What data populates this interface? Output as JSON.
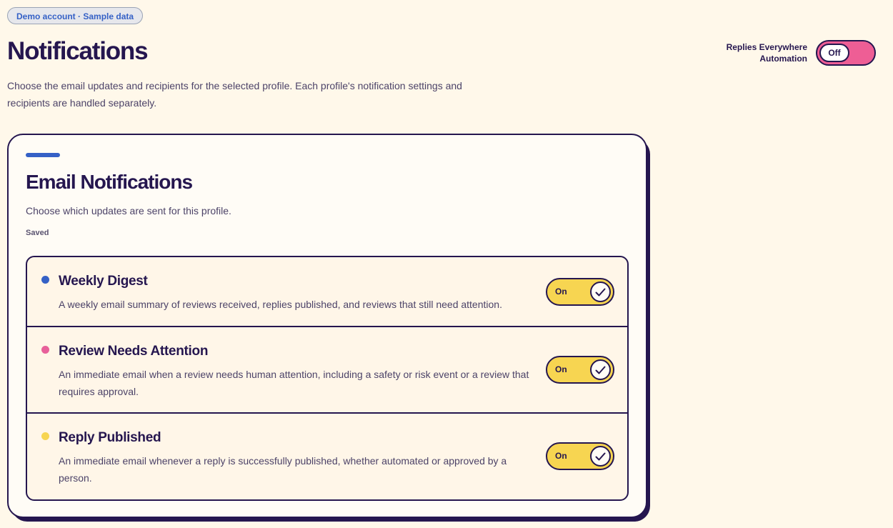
{
  "badge": "Demo account · Sample data",
  "header": {
    "title": "Notifications",
    "description": "Choose the email updates and recipients for the selected profile. Each profile's notification settings and recipients are handled separately."
  },
  "automation": {
    "label_line1": "Replies Everywhere",
    "label_line2": "Automation",
    "toggle_label": "Off",
    "toggle_color": "#ee5e95"
  },
  "card": {
    "title": "Email Notifications",
    "subtitle": "Choose which updates are sent for this profile.",
    "status": "Saved",
    "accent_color": "#3561c6",
    "items": [
      {
        "title": "Weekly Digest",
        "description": "A weekly email summary of reviews received, replies published, and reviews that still need attention.",
        "dot_color": "#3561c6",
        "toggle_label": "On",
        "toggle_icon": "check-icon"
      },
      {
        "title": "Review Needs Attention",
        "description": "An immediate email when a review needs human attention, including a safety or risk event or a review that requires approval.",
        "dot_color": "#e8609a",
        "toggle_label": "On",
        "toggle_icon": "check-icon"
      },
      {
        "title": "Reply Published",
        "description": "An immediate email whenever a reply is successfully published, whether automated or approved by a person.",
        "dot_color": "#f7d551",
        "toggle_label": "On",
        "toggle_icon": "check-icon"
      }
    ]
  }
}
